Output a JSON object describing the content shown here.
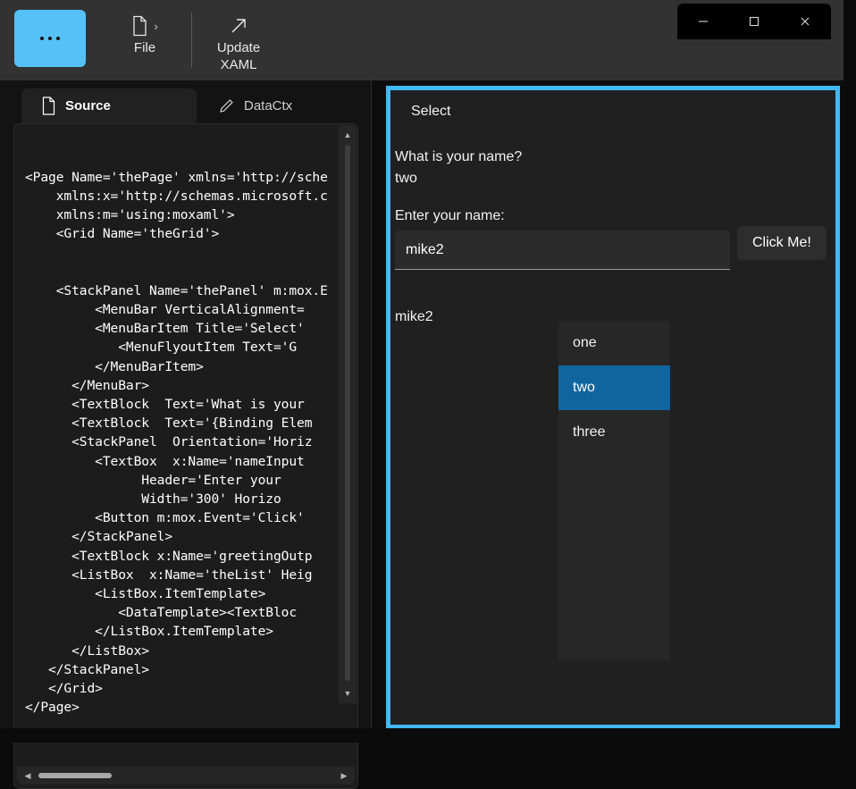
{
  "window": {
    "controls": [
      {
        "name": "minimize",
        "glyph": "minimize-icon"
      },
      {
        "name": "maximize",
        "glyph": "maximize-icon"
      },
      {
        "name": "close",
        "glyph": "close-icon"
      }
    ]
  },
  "toolbar": {
    "app_button_label": "",
    "items": [
      {
        "label": "File",
        "icon": "document-icon",
        "chevron": "›"
      },
      {
        "label": "Update\nXAML",
        "label_line1": "Update",
        "label_line2": "XAML",
        "icon": "arrow-up-right-icon"
      }
    ]
  },
  "left_pane": {
    "tabs": [
      {
        "label": "Source",
        "icon": "document-icon",
        "active": true
      },
      {
        "label": "DataCtx",
        "icon": "pencil-icon",
        "active": false
      }
    ],
    "code": "<Page Name='thePage' xmlns='http://sche\n    xmlns:x='http://schemas.microsoft.c\n    xmlns:m='using:moxaml'>\n    <Grid Name='theGrid'>\n\n\n    <StackPanel Name='thePanel' m:mox.E\n         <MenuBar VerticalAlignment=\n         <MenuBarItem Title='Select'\n            <MenuFlyoutItem Text='G\n         </MenuBarItem>\n      </MenuBar>\n      <TextBlock  Text='What is your \n      <TextBlock  Text='{Binding Elem\n      <StackPanel  Orientation='Horiz\n         <TextBox  x:Name='nameInput\n               Header='Enter your \n               Width='300' Horizo\n         <Button m:mox.Event='Click'\n      </StackPanel>\n      <TextBlock x:Name='greetingOutp\n      <ListBox  x:Name='theList' Heig\n         <ListBox.ItemTemplate>\n            <DataTemplate><TextBloc\n         </ListBox.ItemTemplate>\n      </ListBox>\n   </StackPanel>\n   </Grid>\n</Page>"
  },
  "preview": {
    "menubar": [
      {
        "label": "Select"
      }
    ],
    "question_text": "What is your name?",
    "binding_text": "two",
    "textbox_header": "Enter your name:",
    "textbox_value": "mike2",
    "textbox_placeholder": "",
    "button_label": "Click Me!",
    "greeting_output": "mike2",
    "listbox": {
      "items": [
        {
          "label": "one",
          "selected": false
        },
        {
          "label": "two",
          "selected": true
        },
        {
          "label": "three",
          "selected": false
        }
      ]
    }
  },
  "colors": {
    "accent_blue": "#54c1f7",
    "preview_border": "#44b7f5",
    "selection_blue": "#11659f",
    "toolbar_bg": "#323232",
    "panel_bg": "#202020",
    "code_bg": "#1c1c1c"
  }
}
